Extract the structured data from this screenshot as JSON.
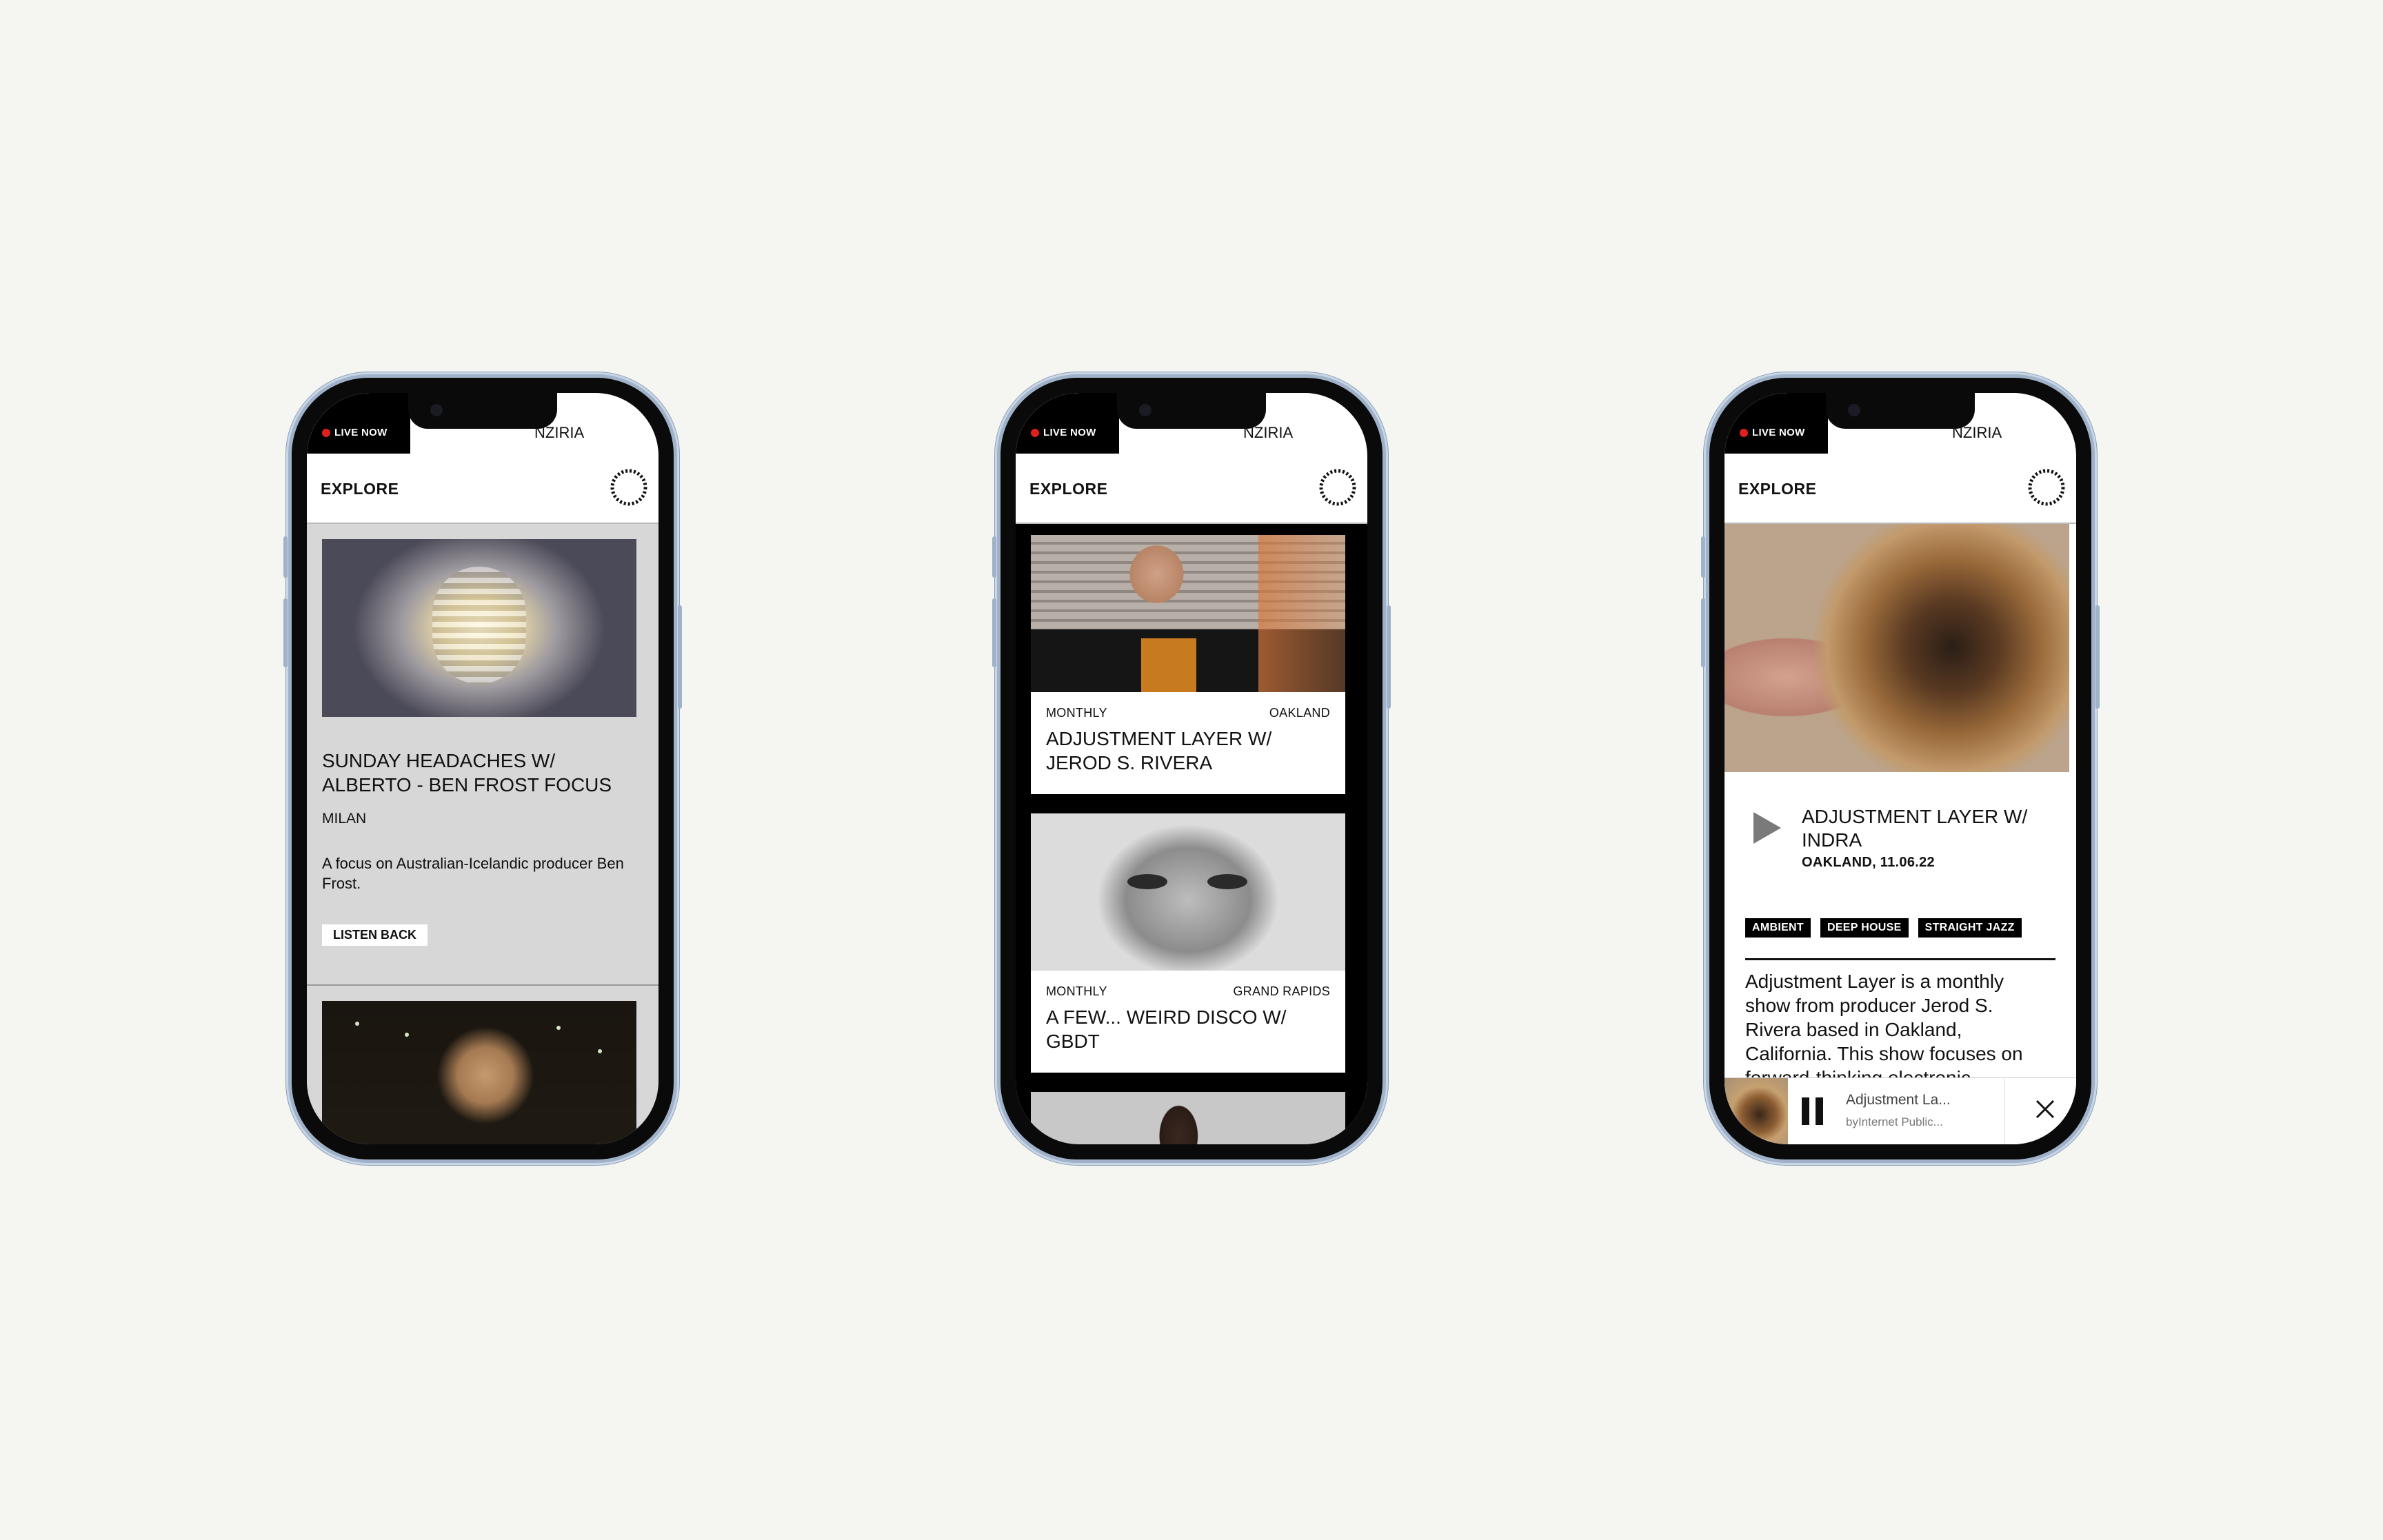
{
  "status_bar": {
    "live_label": "LIVE NOW",
    "ticker_text": "NZIRIA"
  },
  "header": {
    "title": "EXPLORE",
    "logo_text": "INTERNET PUBLIC RADIO"
  },
  "phone1": {
    "featured": {
      "title": "SUNDAY HEADACHES W/ ALBERTO - BEN FROST FOCUS",
      "location": "MILAN",
      "description": "A focus on Australian-Icelandic producer Ben Frost.",
      "button": "LISTEN BACK"
    }
  },
  "phone2": {
    "cards": [
      {
        "frequency": "MONTHLY",
        "location": "OAKLAND",
        "title": "ADJUSTMENT LAYER W/ JEROD S. RIVERA"
      },
      {
        "frequency": "MONTHLY",
        "location": "GRAND RAPIDS",
        "title": "A FEW... WEIRD DISCO W/ GBDT"
      }
    ]
  },
  "phone3": {
    "show": {
      "title": "ADJUSTMENT LAYER W/ INDRA",
      "subtitle": "OAKLAND, 11.06.22",
      "tags": [
        "AMBIENT",
        "DEEP HOUSE",
        "STRAIGHT JAZZ"
      ],
      "description": "Adjustment Layer is a monthly show from producer Jerod S. Rivera based in Oakland, California. This show focuses on forward-thinking electronic"
    },
    "player": {
      "track": "Adjustment La...",
      "by": "byInternet Public..."
    }
  },
  "colors": {
    "page_background": "#f5f5f1",
    "live_dot": "#e01f1f",
    "phone_frame": "#9fb2c9"
  }
}
